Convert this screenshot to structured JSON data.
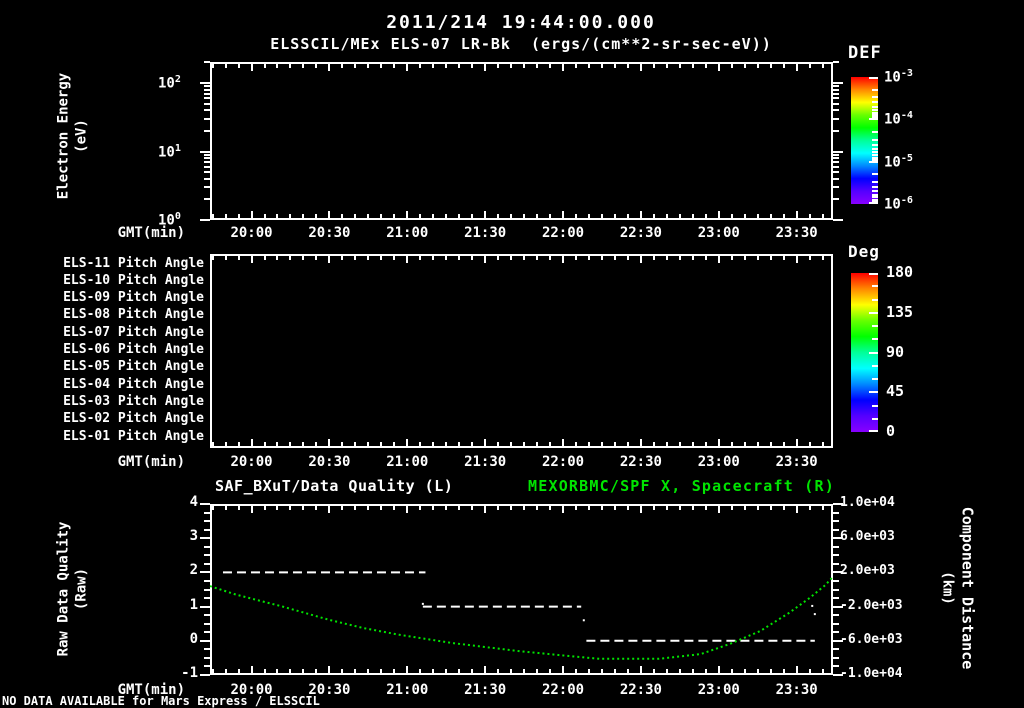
{
  "header": {
    "datetime": "2011/214 19:44:00.000",
    "plot_title": "ELSSCIL/MEx ELS-07 LR-Bk  (ergs/(cm**2-sr-sec-eV))"
  },
  "colors": {
    "background": "#000000",
    "foreground": "#ffffff",
    "accent_green": "#00e400",
    "rainbow": [
      "#ff0000",
      "#ff8800",
      "#ffff00",
      "#66ff00",
      "#00ff00",
      "#00ff99",
      "#00ffff",
      "#0088ff",
      "#0000ff",
      "#5500ff",
      "#8800ff"
    ]
  },
  "axis": {
    "x_label": "GMT(min)",
    "x_tick_labels": [
      "20:00",
      "20:30",
      "21:00",
      "21:30",
      "22:00",
      "22:30",
      "23:00",
      "23:30"
    ],
    "x_start_gmt": "19:44",
    "x_end_gmt": "23:44",
    "x_minor_step_min": 5
  },
  "spectrogram_panel": {
    "y_label_line1": "Electron Energy",
    "y_label_line2": "(eV)",
    "y_tick_base": "10",
    "y_tick_exponents": [
      "2",
      "1",
      "0"
    ],
    "colorbar": {
      "label": "DEF",
      "tick_base": "10",
      "tick_exponents": [
        "-3",
        "-4",
        "-5",
        "-6"
      ]
    }
  },
  "pitch_panel": {
    "row_labels": [
      "ELS-11 Pitch Angle",
      "ELS-10 Pitch Angle",
      "ELS-09 Pitch Angle",
      "ELS-08 Pitch Angle",
      "ELS-07 Pitch Angle",
      "ELS-06 Pitch Angle",
      "ELS-05 Pitch Angle",
      "ELS-04 Pitch Angle",
      "ELS-03 Pitch Angle",
      "ELS-02 Pitch Angle",
      "ELS-01 Pitch Angle"
    ],
    "colorbar": {
      "label": "Deg",
      "tick_labels": [
        "180",
        "135",
        "90",
        "45",
        "0"
      ]
    }
  },
  "timeseries_panel": {
    "title_left": "SAF_BXuT/Data Quality (L)",
    "title_right": "MEXORBMC/SPF X, Spacecraft (R)",
    "y_left_label_line1": "Raw Data Quality",
    "y_left_label_line2": "(Raw)",
    "y_left_ticks": [
      "4",
      "3",
      "2",
      "1",
      "0",
      "-1"
    ],
    "y_right_label_line1": "Component Distance",
    "y_right_label_line2": "(km)",
    "y_right_ticks": [
      "1.0e+04",
      "6.0e+03",
      "2.0e+03",
      "-2.0e+03",
      "-6.0e+03",
      "-1.0e+04"
    ]
  },
  "footer": {
    "message": "NO DATA AVAILABLE for Mars Express / ELSSCIL"
  },
  "chart_data": [
    {
      "type": "heatmap",
      "title": "ELSSCIL/MEx ELS-07 LR-Bk (ergs/(cm**2-sr-sec-eV))",
      "xlabel": "GMT(min)",
      "ylabel": "Electron Energy (eV)",
      "x_range_gmt": [
        "19:44",
        "23:44"
      ],
      "x_ticks": [
        "20:00",
        "20:30",
        "21:00",
        "21:30",
        "22:00",
        "22:30",
        "23:00",
        "23:30"
      ],
      "y_scale": "log",
      "y_ticks": [
        1,
        10,
        100
      ],
      "colorbar": {
        "label": "DEF",
        "scale": "log",
        "ticks": [
          0.001,
          0.0001,
          1e-05,
          1e-06
        ]
      },
      "values": "none — panel is blank (no data plotted)"
    },
    {
      "type": "heatmap",
      "rows": [
        "ELS-11 Pitch Angle",
        "ELS-10 Pitch Angle",
        "ELS-09 Pitch Angle",
        "ELS-08 Pitch Angle",
        "ELS-07 Pitch Angle",
        "ELS-06 Pitch Angle",
        "ELS-05 Pitch Angle",
        "ELS-04 Pitch Angle",
        "ELS-03 Pitch Angle",
        "ELS-02 Pitch Angle",
        "ELS-01 Pitch Angle"
      ],
      "xlabel": "GMT(min)",
      "x_range_gmt": [
        "19:44",
        "23:44"
      ],
      "x_ticks": [
        "20:00",
        "20:30",
        "21:00",
        "21:30",
        "22:00",
        "22:30",
        "23:00",
        "23:30"
      ],
      "colorbar": {
        "label": "Deg",
        "range": [
          0,
          180
        ],
        "ticks": [
          180,
          135,
          90,
          45,
          0
        ]
      },
      "values": "none — panel is blank (no data plotted)"
    },
    {
      "type": "line",
      "xlabel": "GMT(min)",
      "x_range_gmt": [
        "19:44",
        "23:44"
      ],
      "x_ticks": [
        "20:00",
        "20:30",
        "21:00",
        "21:30",
        "22:00",
        "22:30",
        "23:00",
        "23:30"
      ],
      "left_axis": {
        "label": "Raw Data Quality (Raw)",
        "lim": [
          -1,
          4
        ],
        "ticks": [
          4,
          3,
          2,
          1,
          0,
          -1
        ]
      },
      "right_axis": {
        "label": "Component Distance (km)",
        "lim": [
          -10000,
          10000
        ],
        "ticks": [
          10000,
          6000,
          2000,
          -2000,
          -6000,
          -10000
        ]
      },
      "series": [
        {
          "name": "SAF_BXuT/Data Quality (L)",
          "axis": "left",
          "color": "#ffffff",
          "style": "dashed",
          "segments": [
            {
              "value": 2,
              "gmt_start": "19:49",
              "gmt_end": "21:07"
            },
            {
              "value": 1,
              "gmt_start": "21:06",
              "gmt_end": "22:07"
            },
            {
              "value": 0,
              "gmt_start": "22:09",
              "gmt_end": "23:37"
            }
          ],
          "isolated_points": [
            {
              "gmt": "21:06",
              "value": 1.08
            },
            {
              "gmt": "22:08",
              "value": 0.6
            },
            {
              "gmt": "23:36",
              "value": 1.02
            },
            {
              "gmt": "23:37",
              "value": 0.78
            }
          ]
        },
        {
          "name": "MEXORBMC/SPF X, Spacecraft (R)",
          "axis": "right",
          "color": "#00e400",
          "style": "dotted",
          "points_gmt_km": [
            [
              "19:44",
              400
            ],
            [
              "19:54",
              -600
            ],
            [
              "20:12",
              -2000
            ],
            [
              "20:30",
              -3550
            ],
            [
              "20:43",
              -4500
            ],
            [
              "20:57",
              -5300
            ],
            [
              "21:17",
              -6250
            ],
            [
              "21:43",
              -7200
            ],
            [
              "22:03",
              -7800
            ],
            [
              "22:14",
              -8100
            ],
            [
              "22:37",
              -8100
            ],
            [
              "22:53",
              -7550
            ],
            [
              "23:04",
              -6400
            ],
            [
              "23:16",
              -4850
            ],
            [
              "23:27",
              -2750
            ],
            [
              "23:35",
              -1000
            ],
            [
              "23:41",
              500
            ],
            [
              "23:44",
              1500
            ]
          ]
        }
      ]
    }
  ]
}
